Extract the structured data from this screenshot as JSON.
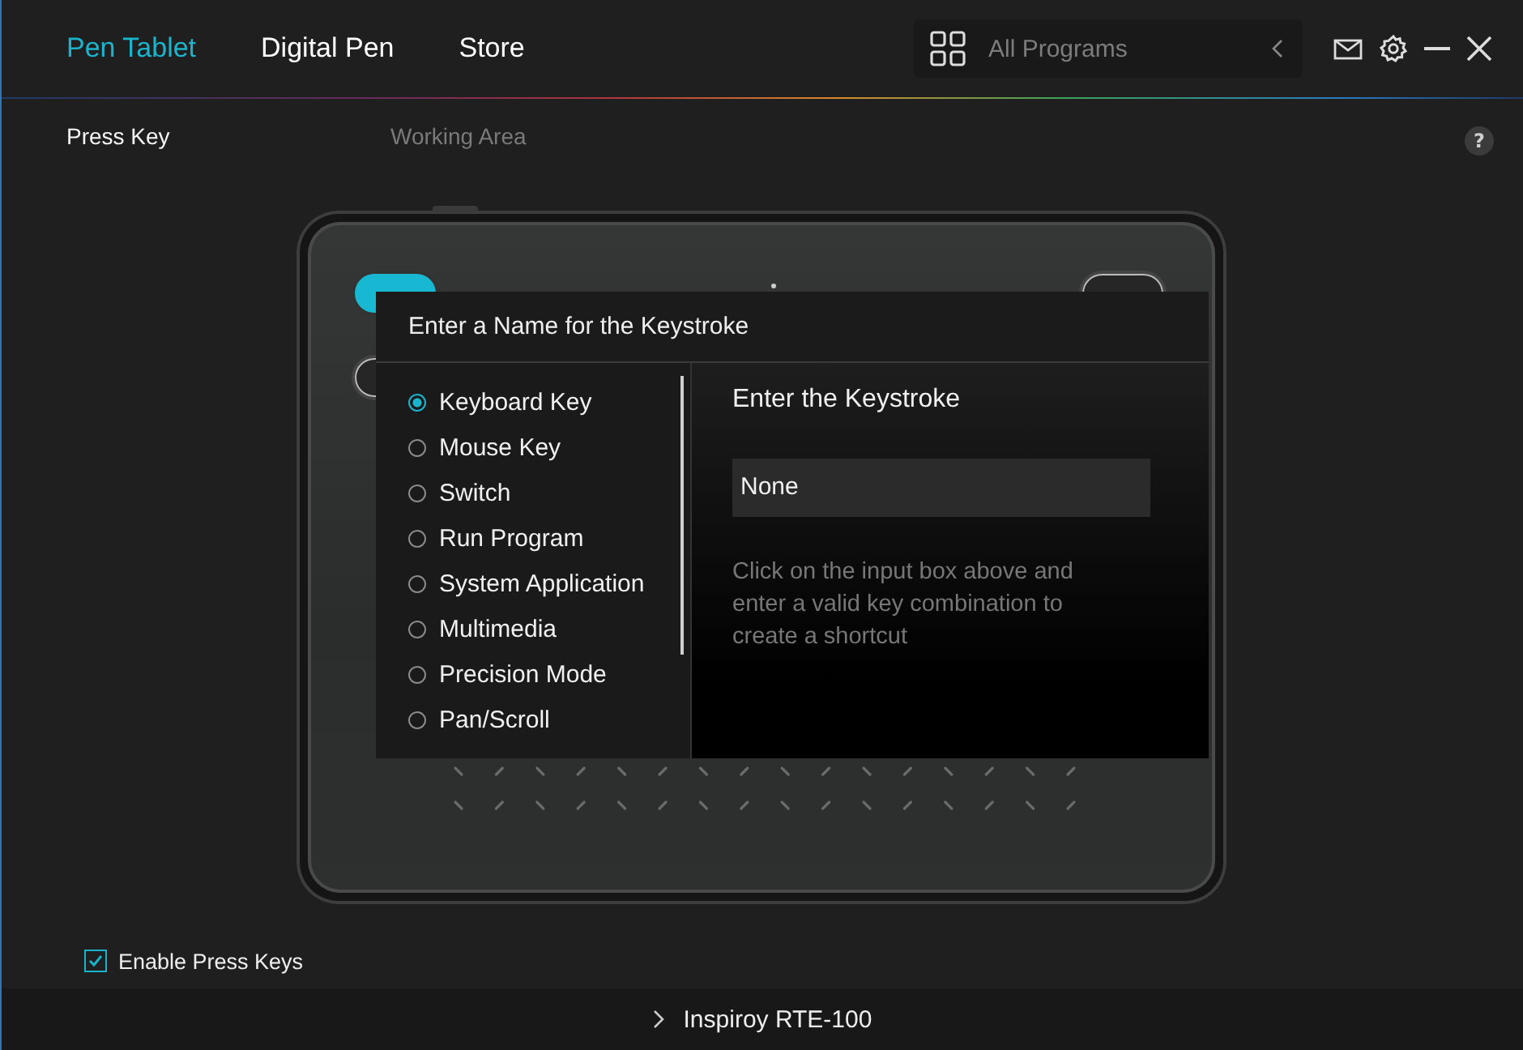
{
  "tabs": [
    {
      "label": "Pen Tablet",
      "selected": true
    },
    {
      "label": "Digital Pen",
      "selected": false
    },
    {
      "label": "Store",
      "selected": false
    }
  ],
  "program_selector": {
    "label": "All Programs"
  },
  "subtabs": [
    {
      "label": "Press Key",
      "selected": true
    },
    {
      "label": "Working Area",
      "selected": false
    }
  ],
  "help": "?",
  "tablet": {
    "keys": [
      {
        "selected": true
      },
      {
        "selected": false
      },
      {
        "selected": false
      }
    ]
  },
  "dialog": {
    "title": "Enter a Name for the Keystroke",
    "options": [
      {
        "label": "Keyboard Key",
        "selected": true
      },
      {
        "label": "Mouse Key",
        "selected": false
      },
      {
        "label": "Switch",
        "selected": false
      },
      {
        "label": "Run Program",
        "selected": false
      },
      {
        "label": "System Application",
        "selected": false
      },
      {
        "label": "Multimedia",
        "selected": false
      },
      {
        "label": "Precision Mode",
        "selected": false
      },
      {
        "label": "Pan/Scroll",
        "selected": false
      }
    ],
    "keystroke": {
      "title": "Enter the Keystroke",
      "value": "None",
      "hint": "Click on the input box above and enter a valid key combination to create a shortcut"
    }
  },
  "enable_press_keys": {
    "label": "Enable Press Keys",
    "checked": true
  },
  "device": {
    "name": "Inspiroy RTE-100"
  }
}
